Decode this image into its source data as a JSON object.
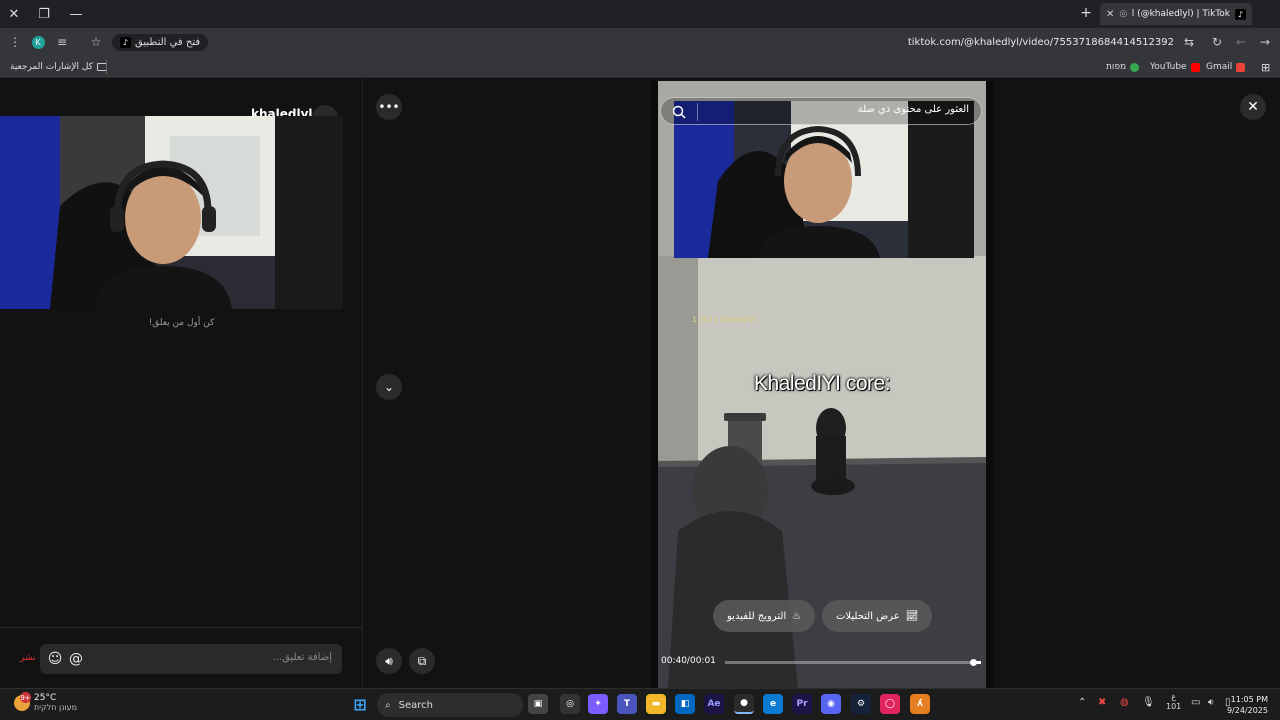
{
  "browser": {
    "tab_title": "khaledlyl (@khaledlyl) | TikTok",
    "tab_icon": "tiktok-icon",
    "open_in_app_label": "فتح في التطبيق",
    "profile_letter": "K",
    "url": "tiktok.com/@khaledlyl/video/7553718684414512392",
    "bookmarks": {
      "all_bookmarks_label": "كل الإشارات المرجعية",
      "gmail": "Gmail",
      "youtube": "YouTube",
      "maps": "מפות"
    }
  },
  "comments_panel": {
    "username": "khaledlyl",
    "first_comment_prompt": "كن أول من يعلق!",
    "add_comment_placeholder": "إضافة تعليق...",
    "post_label": "نشر"
  },
  "player": {
    "search_placeholder": "العثور على محتوى ذي صلة",
    "overlay_text": "KhaledIYI core:",
    "in_game_tag": "1193 | khaledlyl",
    "promote_label": "الترويج للفيديو",
    "analytics_label": "عرض التحليلات",
    "time_label": "00:40/00:01",
    "progress_fraction": 0.03
  },
  "taskbar": {
    "weather_temp": "25°C",
    "weather_desc": "מעונן חלקית",
    "weather_badge": "9+",
    "search_label": "Search",
    "lang_label": "ع",
    "lang_sub": "101",
    "time": "11:05 PM",
    "date": "9/24/2025"
  },
  "colors": {
    "page_bg": "#121212",
    "accent_red": "#fe2c55",
    "chrome_dark": "#202124",
    "chrome_mid": "#35363a"
  }
}
